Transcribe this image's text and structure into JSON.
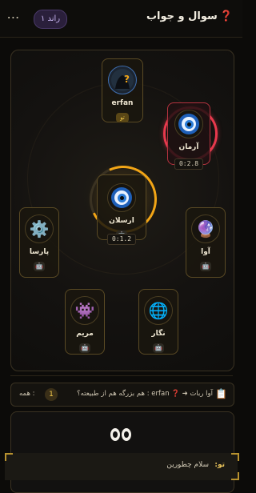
{
  "header": {
    "title_icon": "question-mark",
    "title": "سوال و جواب",
    "round_label": "راند ۱",
    "more_label": "⋯"
  },
  "colors": {
    "accent_gold": "#f2a516",
    "accent_red": "#e8394d",
    "purple_badge": "#c9b6f2"
  },
  "players": [
    {
      "id": "erfan",
      "name": "erfan",
      "avatar": "hooded-question-avatar",
      "badge": "تو",
      "active": false
    },
    {
      "id": "arman",
      "name": "آرمان",
      "avatar": "nazar-eye-icon",
      "timer": "0:2.8",
      "ring": "red"
    },
    {
      "id": "arslan",
      "name": "ارسلان",
      "avatar": "nazar-eye-icon",
      "badge": "🤖",
      "timer": "0:1.2",
      "ring": "gold"
    },
    {
      "id": "parsa",
      "name": "پارسا",
      "avatar": "gear-icon",
      "badge": "🤖"
    },
    {
      "id": "ava",
      "name": "آوا",
      "avatar": "crystal-ball-icon",
      "badge": "🤖"
    },
    {
      "id": "maryam",
      "name": "مریم",
      "avatar": "alien-monster-icon",
      "badge": "🤖"
    },
    {
      "id": "negar",
      "name": "نگار",
      "avatar": "globe-icon",
      "badge": "🤖"
    }
  ],
  "activity": {
    "text": "آوا ربات ➜ ❓ erfan : هم بزرگه هم از طبیعته؟",
    "count": "1",
    "all_label": ": همه"
  },
  "chat": {
    "eyes": "👀",
    "last_sender": "تو:",
    "last_message": "سلام چطورین"
  }
}
